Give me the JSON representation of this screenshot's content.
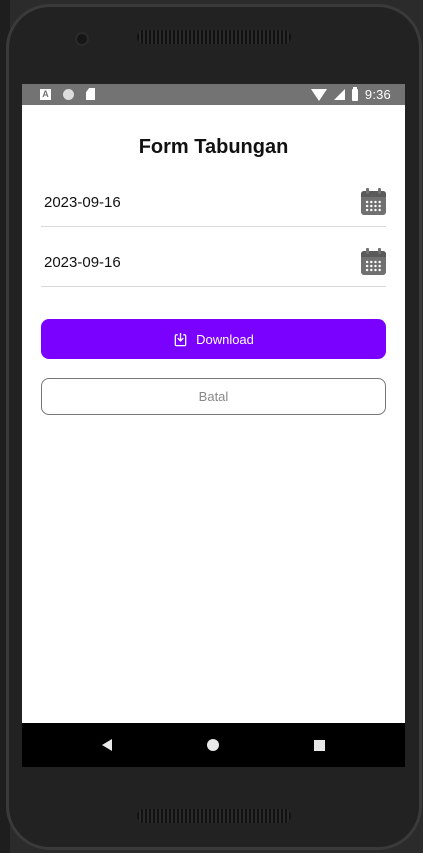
{
  "status_bar": {
    "time": "9:36",
    "left_icons": [
      "notification-a-icon",
      "circle-icon",
      "sd-card-icon"
    ],
    "right_icons": [
      "wifi-icon",
      "signal-icon",
      "battery-icon"
    ]
  },
  "form": {
    "title": "Form Tabungan",
    "start_date": "2023-09-16",
    "end_date": "2023-09-16",
    "download_label": "Download",
    "cancel_label": "Batal"
  },
  "colors": {
    "accent": "#7a00ff",
    "status_bar": "#737373",
    "nav_bar": "#000000"
  },
  "nav_bar": {
    "buttons": [
      "back-icon",
      "home-icon",
      "recents-icon"
    ]
  }
}
